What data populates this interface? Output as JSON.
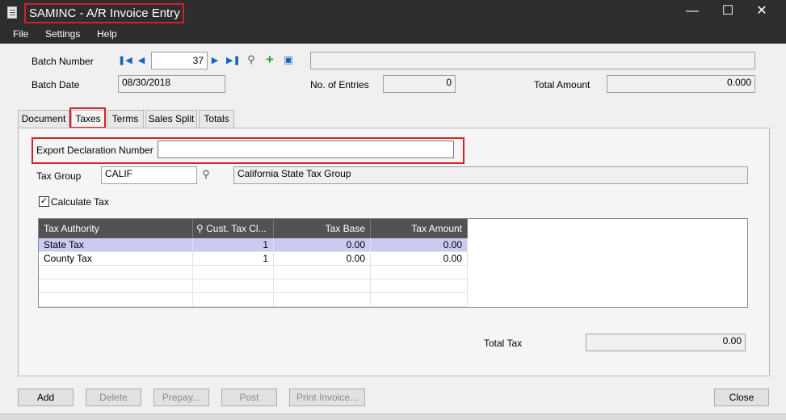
{
  "window": {
    "title": "SAMINC - A/R Invoice Entry"
  },
  "menu": {
    "file": "File",
    "settings": "Settings",
    "help": "Help"
  },
  "header": {
    "batch_number_label": "Batch Number",
    "batch_number_value": "37",
    "batch_description": "",
    "batch_date_label": "Batch Date",
    "batch_date_value": "08/30/2018",
    "entries_label": "No. of Entries",
    "entries_value": "0",
    "total_amount_label": "Total Amount",
    "total_amount_value": "0.000"
  },
  "tabs": [
    "Document",
    "Taxes",
    "Terms",
    "Sales Split",
    "Totals"
  ],
  "taxes": {
    "export_label": "Export Declaration Number",
    "export_value": "",
    "tax_group_label": "Tax Group",
    "tax_group_value": "CALIF",
    "tax_group_description": "California State Tax Group",
    "calculate_tax_label": "Calculate Tax",
    "calculate_tax_checked": "✓",
    "columns": [
      "Tax Authority",
      "Cust. Tax Cl...",
      "Tax Base",
      "Tax Amount"
    ],
    "rows": [
      {
        "authority": "State Tax",
        "class": "1",
        "base": "0.00",
        "amount": "0.00"
      },
      {
        "authority": "County Tax",
        "class": "1",
        "base": "0.00",
        "amount": "0.00"
      }
    ],
    "total_tax_label": "Total Tax",
    "total_tax_value": "0.00"
  },
  "buttons": {
    "add": "Add",
    "delete": "Delete",
    "prepay": "Prepay...",
    "post": "Post",
    "print": "Print Invoice...",
    "close": "Close"
  },
  "colors": {
    "highlight": "#d42027",
    "titlebar": "#2d2d30",
    "grid_header": "#525252",
    "selected_row": "#cbcbf2"
  }
}
